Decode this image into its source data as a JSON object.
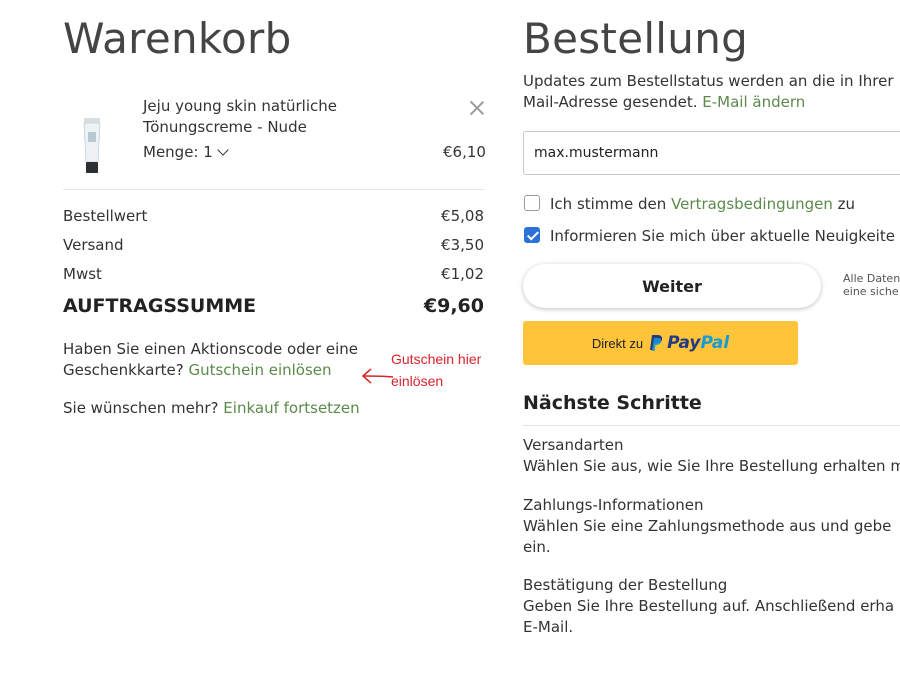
{
  "cart": {
    "title": "Warenkorb",
    "item": {
      "name_line1": "Jeju young skin natürliche",
      "name_line2": "Tönungscreme - Nude",
      "quantity_label": "Menge: 1",
      "price": "€6,10",
      "close_icon": "close-icon"
    },
    "summary": [
      {
        "label": "Bestellwert",
        "value": "€5,08"
      },
      {
        "label": "Versand",
        "value": "€3,50"
      },
      {
        "label": "Mwst",
        "value": "€1,02"
      }
    ],
    "total": {
      "label": "AUFTRAGSSUMME",
      "value": "€9,60"
    },
    "promo_line1": "Haben Sie einen Aktionscode oder eine",
    "promo_line2": "Geschenkkarte?",
    "promo_link": "Gutschein einlösen",
    "more_text": "Sie wünschen mehr?",
    "more_link": "Einkauf fortsetzen"
  },
  "annotation": {
    "line1": "Gutschein hier",
    "line2": "einlösen",
    "color": "#d8232a"
  },
  "order": {
    "title": "Bestellung",
    "info_line1": "Updates zum Bestellstatus werden an die in Ihrer",
    "info_line2": "Mail-Adresse gesendet.",
    "change_email_link": "E-Mail ändern",
    "email_value": "max.mustermann",
    "terms_text_before": "Ich stimme den",
    "terms_link": "Vertragsbedingungen",
    "terms_text_after": "zu",
    "newsletter_text": "Informieren Sie mich über aktuelle Neuigkeite",
    "newsletter_checked": true,
    "continue_button": "Weiter",
    "side_note_line1": "Alle Daten",
    "side_note_line2": "eine siche",
    "paypal_prefix": "Direkt zu",
    "paypal_word_pay": "Pay",
    "paypal_word_pal": "Pal",
    "next_steps_title": "Nächste Schritte",
    "steps": [
      {
        "title": "Versandarten",
        "desc1": "Wählen Sie aus, wie Sie Ihre Bestellung erhalten m",
        "desc2": ""
      },
      {
        "title": "Zahlungs-Informationen",
        "desc1": "Wählen Sie eine Zahlungsmethode aus und gebe",
        "desc2": "ein."
      },
      {
        "title": "Bestätigung der Bestellung",
        "desc1": "Geben Sie Ihre Bestellung auf. Anschließend erha",
        "desc2": "E-Mail."
      }
    ]
  },
  "colors": {
    "accent_green": "#5b8a4a",
    "checkbox_blue": "#2a72d8",
    "paypal_yellow": "#ffc439",
    "paypal_dark": "#253b80",
    "paypal_light": "#179bd7"
  }
}
